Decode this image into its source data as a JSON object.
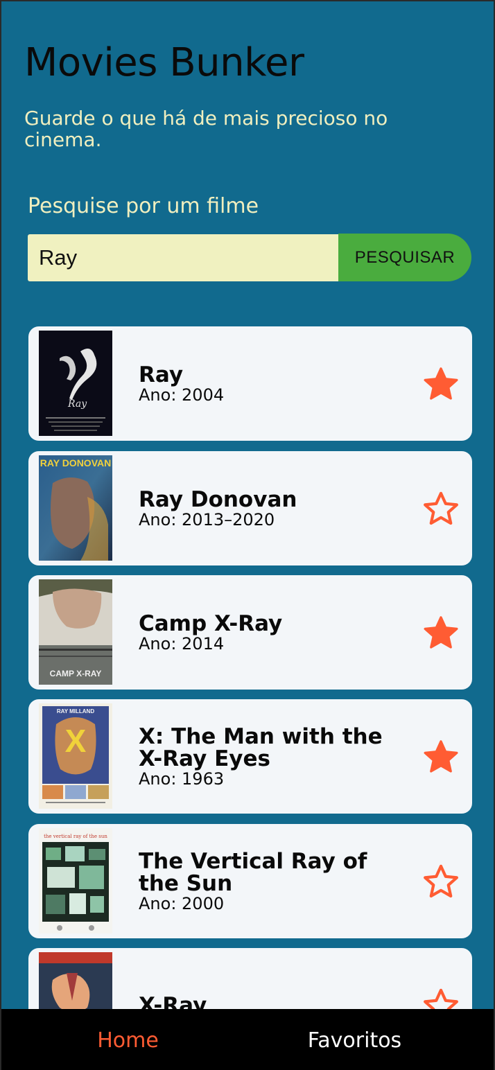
{
  "app": {
    "title": "Movies Bunker",
    "subtitle": "Guarde o que há de mais precioso no cinema."
  },
  "search": {
    "label": "Pesquise por um filme",
    "value": "Ray",
    "button_label": "PESQUISAR"
  },
  "results": [
    {
      "title": "Ray",
      "year": "Ano: 2004",
      "favorite": true
    },
    {
      "title": "Ray Donovan",
      "year": "Ano: 2013–2020",
      "favorite": false
    },
    {
      "title": "Camp X-Ray",
      "year": "Ano: 2014",
      "favorite": true
    },
    {
      "title": "X: The Man with the X-Ray Eyes",
      "year": "Ano: 1963",
      "favorite": true
    },
    {
      "title": "The Vertical Ray of the Sun",
      "year": "Ano: 2000",
      "favorite": false
    },
    {
      "title": "X-Ray",
      "year": "",
      "favorite": false
    }
  ],
  "poster_texts": {
    "ray_donovan": "RAY DONOVAN",
    "camp_xray": "CAMP X-RAY",
    "xray_eyes_top": "RAY MILLAND",
    "xray_eyes_letter": "X",
    "vertical_ray": "the vertical ray of the sun"
  },
  "nav": {
    "home_label": "Home",
    "favorites_label": "Favoritos"
  },
  "colors": {
    "background": "#116a8e",
    "accent_text": "#f0efbf",
    "search_button": "#4aac3e",
    "star": "#ff5c33",
    "active_tab": "#ff5c33",
    "inactive_tab": "#ffffff"
  }
}
